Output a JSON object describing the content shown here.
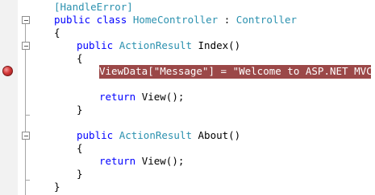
{
  "code": {
    "line1": {
      "attr": "[HandleError]"
    },
    "line2": {
      "kw": "public class",
      "name": "HomeController",
      "sep": ":",
      "base": "Controller"
    },
    "line3": {
      "text": "{"
    },
    "line4": {
      "kw": "public",
      "type": "ActionResult",
      "name": "Index()"
    },
    "line5": {
      "text": "{"
    },
    "line6": {
      "text": "ViewData[\"Message\"] = \"Welcome to ASP.NET MVC!\";"
    },
    "line7": {
      "kw": "return",
      "rest": "View();"
    },
    "line8": {
      "text": "}"
    },
    "line9": {
      "kw": "public",
      "type": "ActionResult",
      "name": "About()"
    },
    "line10": {
      "text": "{"
    },
    "line11": {
      "kw": "return",
      "rest": "View();"
    },
    "line12": {
      "text": "}"
    },
    "line13": {
      "text": "}"
    }
  },
  "colors": {
    "keyword": "#0000ff",
    "type": "#2b91af",
    "breakpoint_highlight": "#9b4848",
    "breakpoint": "#d63a3a"
  },
  "icons": [
    "breakpoint-icon",
    "collapse-icon"
  ]
}
